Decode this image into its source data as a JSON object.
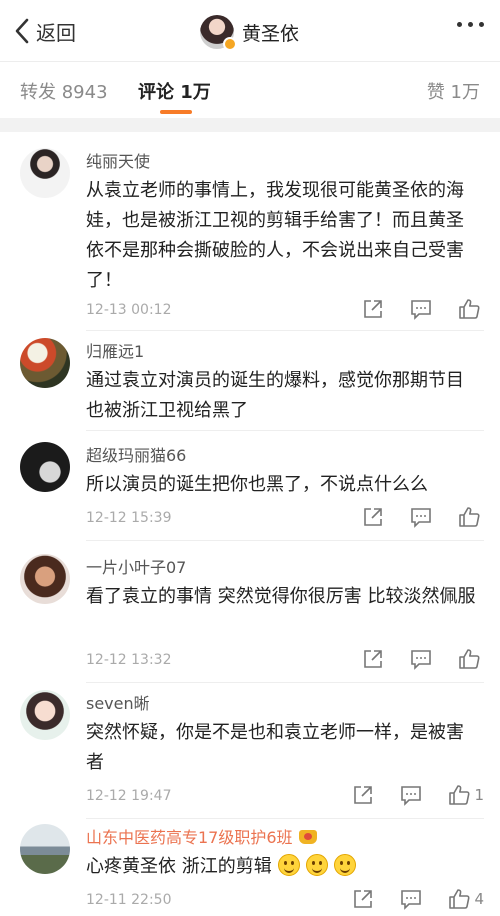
{
  "nav": {
    "back_label": "返回",
    "title": "黄圣依"
  },
  "tabs": {
    "repost": "转发 8943",
    "comment": "评论 1万",
    "like": "赞 1万"
  },
  "comments": [
    {
      "user": "纯丽天使",
      "text": "从袁立老师的事情上，我发现很可能黄圣依的海娃，也是被浙江卫视的剪辑手给害了！而且黄圣依不是那种会撕破脸的人，不会说出来自己受害了！",
      "time": "12-13 00:12",
      "like_count": ""
    },
    {
      "user": "归雁远1",
      "text": "通过袁立对演员的诞生的爆料，感觉你那期节目也被浙江卫视给黑了",
      "time": "",
      "like_count": ""
    },
    {
      "user": "超级玛丽猫66",
      "text": "所以演员的诞生把你也黑了，不说点什么么",
      "time": "12-12 15:39",
      "like_count": ""
    },
    {
      "user": "一片小叶子07",
      "text": "看了袁立的事情 突然觉得你很厉害 比较淡然佩服",
      "time": "12-12 13:32",
      "like_count": ""
    },
    {
      "user": "seven晰",
      "text": "突然怀疑，你是不是也和袁立老师一样，是被害者",
      "time": "12-12 19:47",
      "like_count": "1"
    },
    {
      "user": "山东中医药高专17级职护6班",
      "text": "心疼黄圣依 浙江的剪辑",
      "time": "12-11 22:50",
      "like_count": "4"
    }
  ],
  "colors": {
    "accent": "#f77b27",
    "vip_name": "#eb7350"
  }
}
